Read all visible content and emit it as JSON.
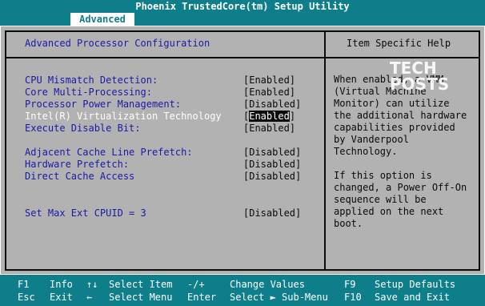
{
  "window": {
    "title": "Phoenix TrustedCore(tm) Setup Utility"
  },
  "tabs": [
    {
      "label": "Advanced"
    }
  ],
  "main": {
    "title": "Advanced Processor Configuration",
    "settings": [
      {
        "label": "CPU Mismatch Detection:",
        "value": "[Enabled]"
      },
      {
        "label": "Core Multi-Processing:",
        "value": "[Enabled]"
      },
      {
        "label": "Processor Power Management:",
        "value": "[Disabled]"
      },
      {
        "label": "Intel(R) Virtualization Technology",
        "value_prefix": "[",
        "value": "Enabled",
        "value_suffix": "]"
      },
      {
        "label": "Execute Disable Bit:",
        "value": "[Enabled]"
      },
      {
        "label": "Adjacent Cache Line Prefetch:",
        "value": "[Disabled]"
      },
      {
        "label": "Hardware Prefetch:",
        "value": "[Disabled]"
      },
      {
        "label": "Direct Cache Access",
        "value": "[Disabled]"
      },
      {
        "label": "Set Max Ext CPUID = 3",
        "value": "[Disabled]"
      }
    ]
  },
  "help": {
    "title": "Item Specific Help",
    "lines": [
      "When enabled, a VMM",
      "(Virtual Machine",
      "Monitor) can utilize",
      "the additional hardware",
      "capabilities provided",
      "by Vanderpool",
      "Technology.",
      "",
      "If this option is",
      "changed, a Power Off-On",
      "sequence will be",
      "applied on the next",
      "boot."
    ]
  },
  "watermark": {
    "line1": "TECH",
    "line2": "POSTS"
  },
  "footer": {
    "row1": [
      {
        "key": "F1",
        "desc": "Info"
      },
      {
        "key": "↑↓",
        "desc": "Select Item"
      },
      {
        "key": "-/+",
        "desc": "Change Values"
      },
      {
        "key": "F9",
        "desc": "Setup Defaults"
      }
    ],
    "row2": [
      {
        "key": "Esc",
        "desc": "Exit"
      },
      {
        "key": "←",
        "desc": "Select Menu"
      },
      {
        "key": "Enter",
        "desc": "Select ► Sub-Menu"
      },
      {
        "key": "F10",
        "desc": "Save and Exit"
      }
    ]
  }
}
